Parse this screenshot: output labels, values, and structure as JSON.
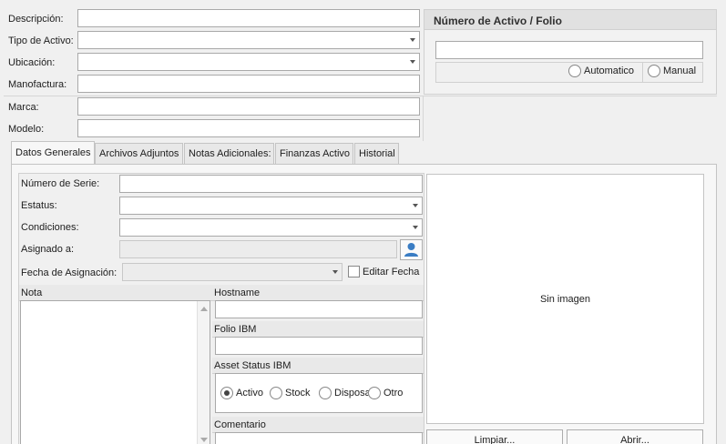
{
  "top_form": {
    "descripcion_label": "Descripción:",
    "tipo_label": "Tipo de Activo:",
    "ubicacion_label": "Ubicación:",
    "manofactura_label": "Manofactura:",
    "marca_label": "Marca:",
    "modelo_label": "Modelo:"
  },
  "folio_group": {
    "title": "Número de Activo / Folio",
    "automatic_label": "Automatico",
    "manual_label": "Manual"
  },
  "tabs": [
    "Datos Generales",
    "Archivos Adjuntos",
    "Notas Adicionales:",
    "Finanzas Activo",
    "Historial"
  ],
  "datos": {
    "serie_label": "Número de Serie:",
    "estatus_label": "Estatus:",
    "condiciones_label": "Condiciones:",
    "asignado_label": "Asignado a:",
    "fecha_label": "Fecha de Asignación:",
    "editar_fecha_label": "Editar Fecha",
    "nota_label": "Nota",
    "hostname_label": "Hostname",
    "folio_ibm_label": "Folio IBM",
    "asset_status_label": "Asset Status IBM",
    "asset_options": [
      "Activo",
      "Stock",
      "Disposa",
      "Otro"
    ],
    "asset_selected": "Activo",
    "comentario_label": "Comentario"
  },
  "image_panel": {
    "placeholder": "Sin imagen",
    "clear_button": "Limpiar...",
    "open_button": "Abrir..."
  },
  "icons": {
    "user_picker": "user-icon"
  }
}
